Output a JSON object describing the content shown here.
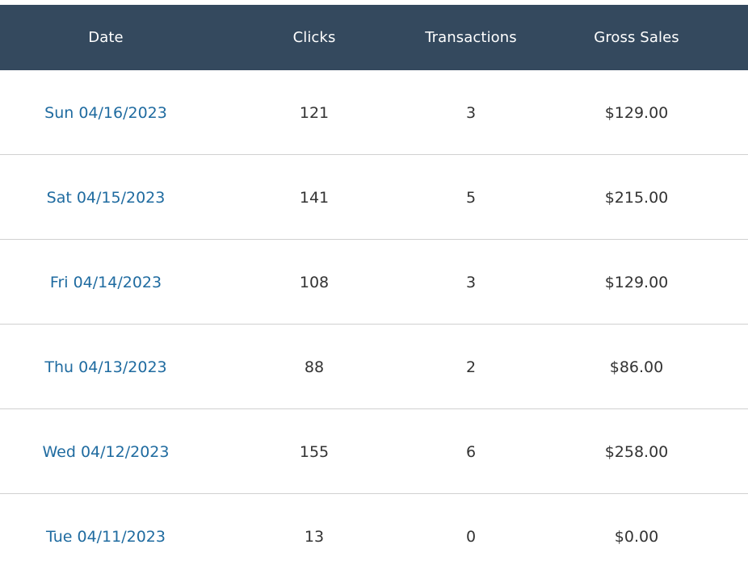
{
  "table": {
    "headers": {
      "date": "Date",
      "clicks": "Clicks",
      "transactions": "Transactions",
      "gross_sales": "Gross Sales"
    },
    "rows": [
      {
        "date": "Sun 04/16/2023",
        "clicks": "121",
        "transactions": "3",
        "gross_sales": "$129.00"
      },
      {
        "date": "Sat 04/15/2023",
        "clicks": "141",
        "transactions": "5",
        "gross_sales": "$215.00"
      },
      {
        "date": "Fri 04/14/2023",
        "clicks": "108",
        "transactions": "3",
        "gross_sales": "$129.00"
      },
      {
        "date": "Thu 04/13/2023",
        "clicks": "88",
        "transactions": "2",
        "gross_sales": "$86.00"
      },
      {
        "date": "Wed 04/12/2023",
        "clicks": "155",
        "transactions": "6",
        "gross_sales": "$258.00"
      },
      {
        "date": "Tue 04/11/2023",
        "clicks": "13",
        "transactions": "0",
        "gross_sales": "$0.00"
      }
    ]
  },
  "colors": {
    "header_bg": "#34495e",
    "link": "#1f6ba0",
    "text": "#333333",
    "divider": "#d0d0d0"
  }
}
